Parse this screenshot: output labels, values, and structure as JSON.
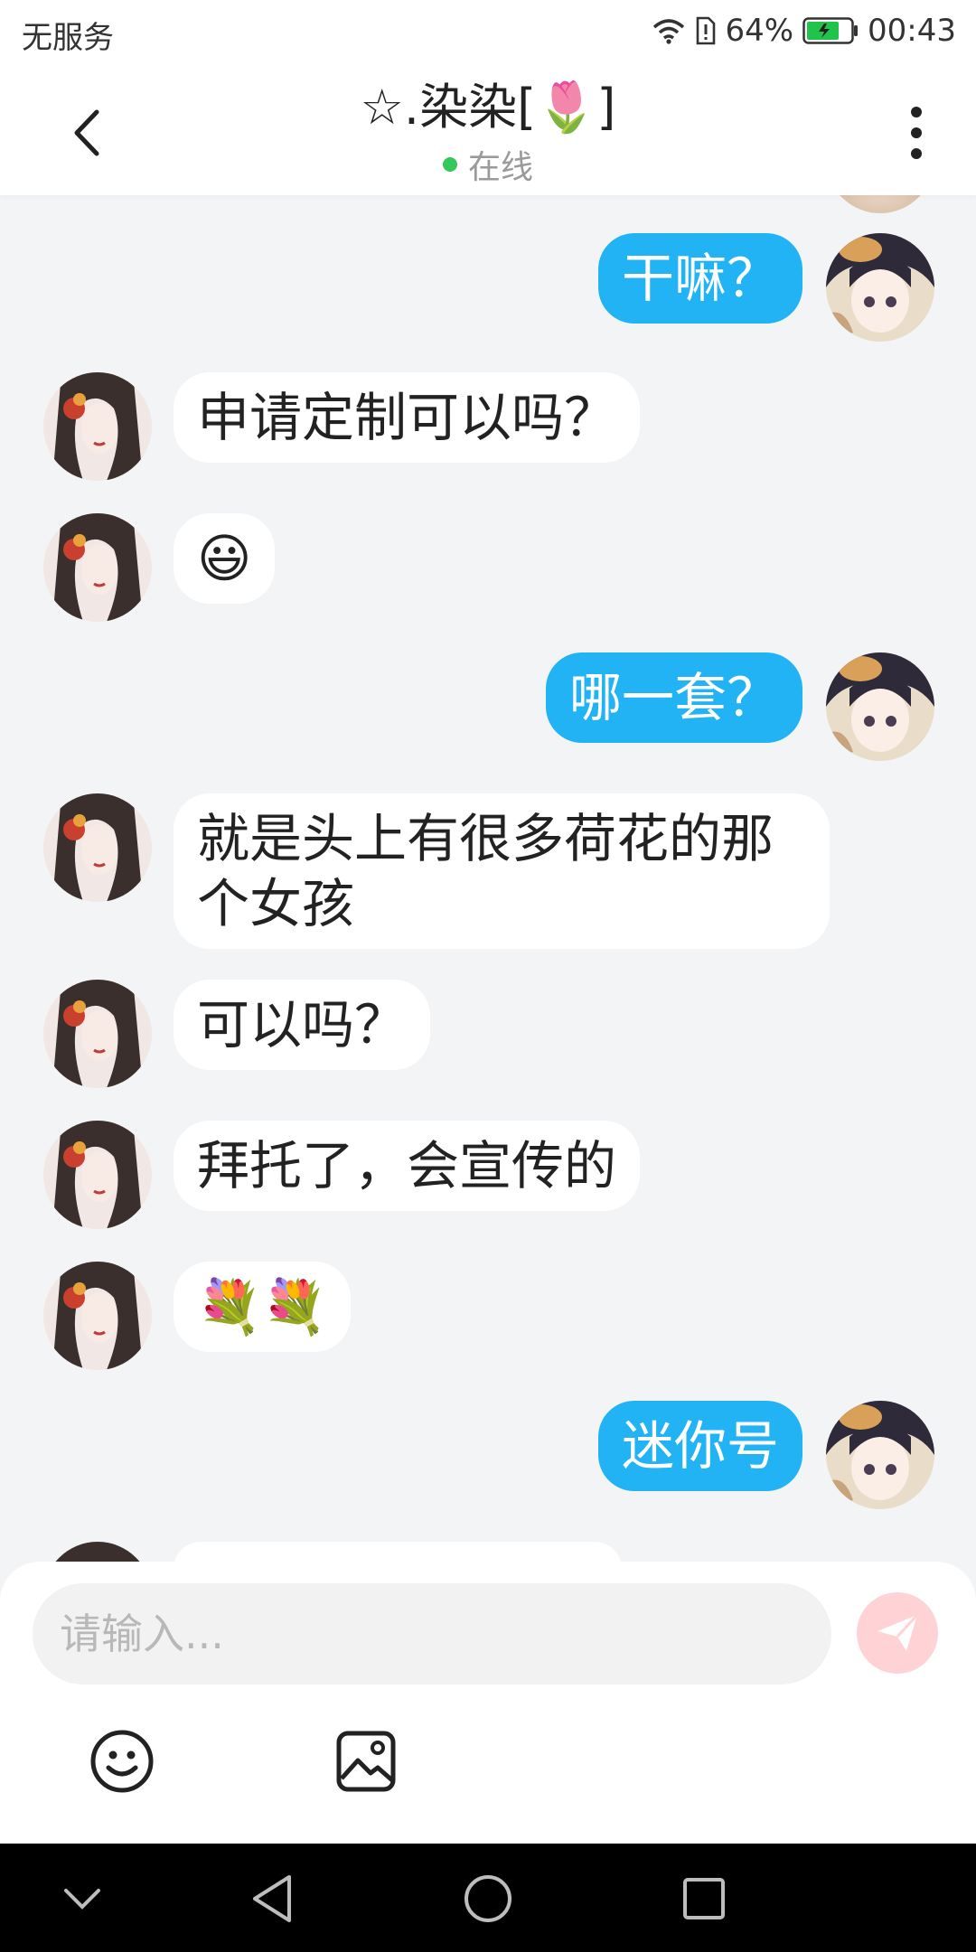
{
  "status_bar": {
    "carrier": "无服务",
    "battery": "64%",
    "time": "00:43"
  },
  "header": {
    "title": "☆.染染[🌷]",
    "status": "在线"
  },
  "messages": [
    {
      "side": "out",
      "text": "干嘛？"
    },
    {
      "side": "in",
      "text": "申请定制可以吗？"
    },
    {
      "side": "in",
      "text": "😃"
    },
    {
      "side": "out",
      "text": "哪一套？"
    },
    {
      "side": "in",
      "text": "就是头上有很多荷花的那个女孩"
    },
    {
      "side": "in",
      "text": "可以吗？"
    },
    {
      "side": "in",
      "text": "拜托了，会宣传的"
    },
    {
      "side": "in",
      "text": "💐💐"
    },
    {
      "side": "out",
      "text": "迷你号"
    }
  ],
  "input": {
    "placeholder": "请输入..."
  },
  "colors": {
    "outgoing_bubble": "#22b3f5",
    "incoming_bubble": "#ffffff",
    "background": "#f3f4f6",
    "online": "#34c759",
    "send_button": "#ffd3d6"
  },
  "icons": {
    "back": "chevron-left-icon",
    "more": "more-vertical-icon",
    "send": "send-icon",
    "emoji": "smiley-icon",
    "image": "image-icon"
  }
}
